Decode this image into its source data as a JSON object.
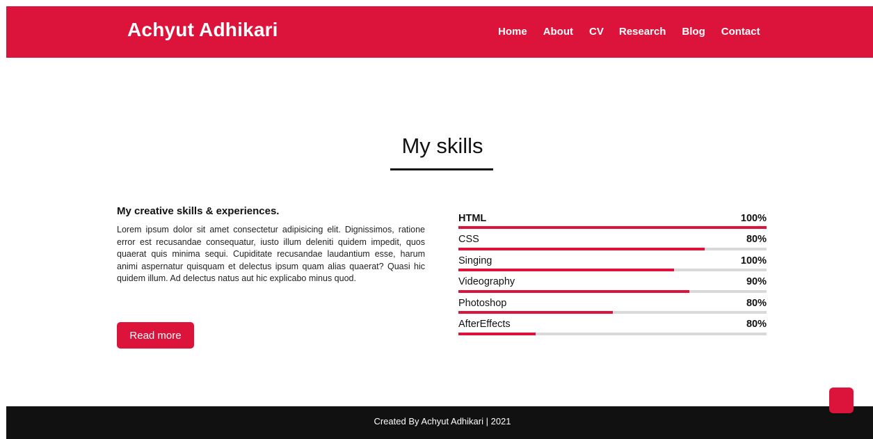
{
  "header": {
    "brand": "Achyut Adhikari",
    "nav": [
      "Home",
      "About",
      "CV",
      "Research",
      "Blog",
      "Contact"
    ]
  },
  "section": {
    "title": "My skills"
  },
  "about": {
    "heading": "My creative skills & experiences.",
    "paragraph": "Lorem ipsum dolor sit amet consectetur adipisicing elit. Dignissimos, ratione error est recusandae consequatur, iusto illum deleniti quidem impedit, quos quaerat quis minima sequi. Cupiditate recusandae laudantium esse, harum animi aspernatur quisquam et delectus ipsum quam alias quaerat? Quasi hic quidem illum. Ad delectus natus aut hic explicabo minus quod.",
    "button": "Read more"
  },
  "skills": [
    {
      "name": "HTML",
      "percent": "100%",
      "fill": 1.0
    },
    {
      "name": "CSS",
      "percent": "80%",
      "fill": 0.8
    },
    {
      "name": "Singing",
      "percent": "100%",
      "fill": 0.7
    },
    {
      "name": "Videography",
      "percent": "90%",
      "fill": 0.75
    },
    {
      "name": "Photoshop",
      "percent": "80%",
      "fill": 0.5
    },
    {
      "name": "AfterEffects",
      "percent": "80%",
      "fill": 0.25
    }
  ],
  "footer": {
    "text": "Created By Achyut Adhikari | 2021"
  },
  "colors": {
    "accent": "#dc143c",
    "footer_bg": "#111111",
    "track": "#d9d9d9"
  },
  "icons": {
    "scroll_top": "scroll-top-icon"
  }
}
